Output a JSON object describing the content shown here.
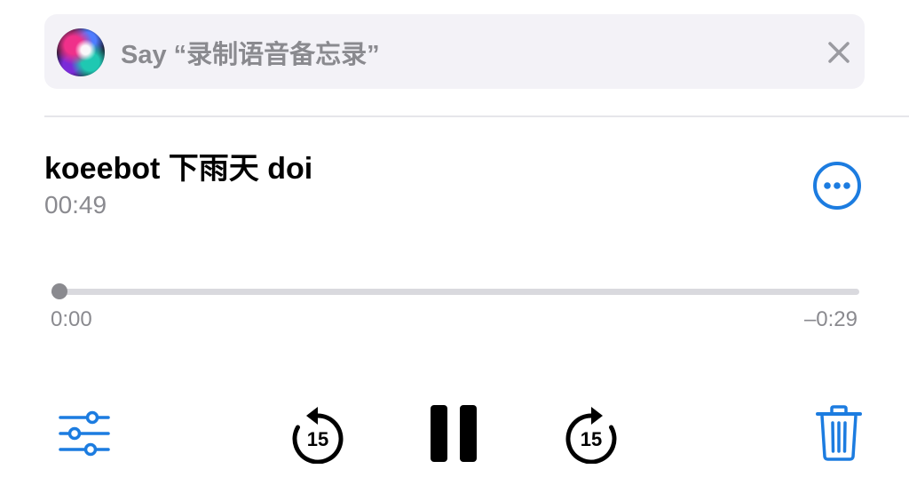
{
  "siri_suggestion": {
    "text": "Say “录制语音备忘录”",
    "icon": "siri-orb-icon",
    "close_icon": "close-icon"
  },
  "memo": {
    "title": "koeebot 下雨天 doi",
    "duration": "00:49"
  },
  "more_button": {
    "icon": "ellipsis-circle-icon"
  },
  "playback": {
    "elapsed": "0:00",
    "remaining": "–0:29",
    "progress": 0.01
  },
  "controls": {
    "edit_icon": "sliders-icon",
    "skip_back_seconds": "15",
    "skip_back_icon": "skip-back-15-icon",
    "play_pause_icon": "pause-icon",
    "skip_forward_seconds": "15",
    "skip_forward_icon": "skip-forward-15-icon",
    "delete_icon": "trash-icon"
  },
  "colors": {
    "accent": "#1c7ce0",
    "secondary_text": "#8a8a8f",
    "banner_bg": "#f3f2f7"
  }
}
